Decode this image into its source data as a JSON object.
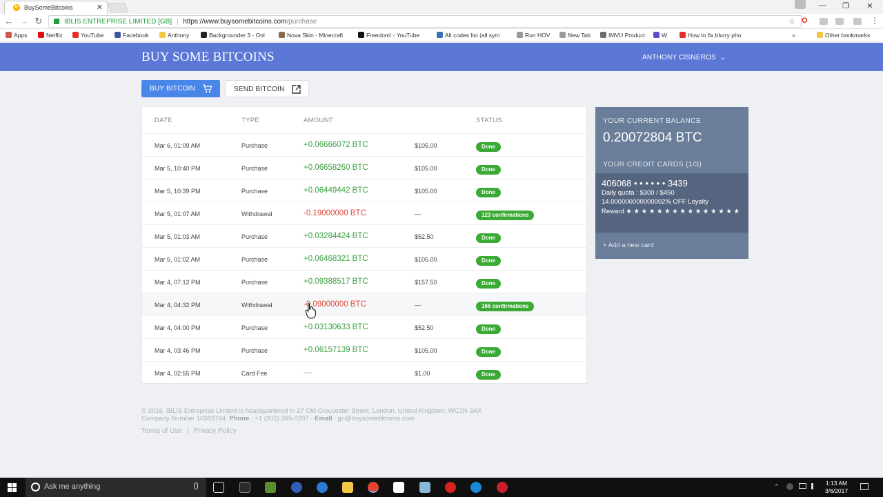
{
  "browser": {
    "tab_title": "BuySomeBitcoins",
    "tab_close": "✕",
    "win_min": "—",
    "win_restore": "❐",
    "win_close": "✕",
    "nav_back": "←",
    "nav_forward": "→",
    "nav_reload": "↻",
    "org": "IBLIS ENTREPRISE LIMITED [GB]",
    "separator": "|",
    "host": "https://www.buysomebitcoins.com",
    "path": "/purchase",
    "star": "☆",
    "bookmarks": [
      {
        "label": "Apps",
        "color": "#d05a4a"
      },
      {
        "label": "Netflix",
        "color": "#e50914"
      },
      {
        "label": "YouTube",
        "color": "#e52d27"
      },
      {
        "label": "Facebook",
        "color": "#3b5998"
      },
      {
        "label": "Anthony",
        "color": "#f2c744"
      },
      {
        "label": "Backgrounder 3 - Onl",
        "color": "#222222"
      },
      {
        "label": "Nova Skin - Minecraft",
        "color": "#8b6a4e"
      },
      {
        "label": "Freedom! - YouTube",
        "color": "#111111"
      },
      {
        "label": "Alt codes list (all sym",
        "color": "#3d6fb8"
      },
      {
        "label": "Run HOV",
        "color": "#9a9a9a"
      },
      {
        "label": "New Tab",
        "color": "#9a9a9a"
      },
      {
        "label": "IMVU Product",
        "color": "#6e6e6e"
      },
      {
        "label": "W",
        "color": "#5a4fc8"
      },
      {
        "label": "How to fix blurry pho",
        "color": "#e52d27"
      }
    ],
    "more_bookmarks": "»",
    "other_bookmarks": "Other bookmarks"
  },
  "header": {
    "logo": "BUY SOME BITCOINS",
    "user": "ANTHONY CISNEROS",
    "chevron": "⌄"
  },
  "actions": {
    "buy_label": "BUY BITCOIN",
    "buy_icon": "🛒",
    "send_label": "SEND BITCOIN",
    "send_icon": "⧉"
  },
  "table": {
    "headers": {
      "date": "DATE",
      "type": "TYPE",
      "amount": "AMOUNT",
      "status": "STATUS"
    },
    "rows": [
      {
        "date": "Mar 6, 01:09 AM",
        "type": "Purchase",
        "amount": "+0.06666072 BTC",
        "sign": "pos",
        "usd": "$105.00",
        "status": "Done"
      },
      {
        "date": "Mar 5, 10:40 PM",
        "type": "Purchase",
        "amount": "+0.06658260 BTC",
        "sign": "pos",
        "usd": "$105.00",
        "status": "Done"
      },
      {
        "date": "Mar 5, 10:39 PM",
        "type": "Purchase",
        "amount": "+0.06449442 BTC",
        "sign": "pos",
        "usd": "$105.00",
        "status": "Done"
      },
      {
        "date": "Mar 5, 01:07 AM",
        "type": "Withdrawal",
        "amount": "-0.19000000 BTC",
        "sign": "neg",
        "usd": "—",
        "status": "123 confirmations"
      },
      {
        "date": "Mar 5, 01:03 AM",
        "type": "Purchase",
        "amount": "+0.03284424 BTC",
        "sign": "pos",
        "usd": "$52.50",
        "status": "Done"
      },
      {
        "date": "Mar 5, 01:02 AM",
        "type": "Purchase",
        "amount": "+0.06468321 BTC",
        "sign": "pos",
        "usd": "$105.00",
        "status": "Done"
      },
      {
        "date": "Mar 4, 07:12 PM",
        "type": "Purchase",
        "amount": "+0.09388517 BTC",
        "sign": "pos",
        "usd": "$157.50",
        "status": "Done"
      },
      {
        "date": "Mar 4, 04:32 PM",
        "type": "Withdrawal",
        "amount": "-0.09000000 BTC",
        "sign": "neg",
        "usd": "—",
        "status": "166 confirmations"
      },
      {
        "date": "Mar 4, 04:00 PM",
        "type": "Purchase",
        "amount": "+0.03130633 BTC",
        "sign": "pos",
        "usd": "$52.50",
        "status": "Done"
      },
      {
        "date": "Mar 4, 03:46 PM",
        "type": "Purchase",
        "amount": "+0.06157139 BTC",
        "sign": "pos",
        "usd": "$105.00",
        "status": "Done"
      },
      {
        "date": "Mar 4, 02:55 PM",
        "type": "Card Fee",
        "amount": "—",
        "sign": "none",
        "usd": "$1.00",
        "status": "Done"
      }
    ]
  },
  "balance": {
    "label": "YOUR CURRENT BALANCE",
    "value": "0.20072804 BTC",
    "cards_label": "YOUR CREDIT CARDS (1/3)",
    "card_number": "406068 • • • • • • 3439",
    "daily_quota": "Daily quota : $300 / $450",
    "loyalty": "14.000000000000002% OFF Loyalty",
    "reward": "Reward ★ ★ ★ ★ ★ ★ ★ ★ ★ ★ ★ ★ ★ ★ ★",
    "add_card": "+ Add a new card"
  },
  "footer": {
    "line1": "© 2016. IBLIS Entreprise Limited is headquartered in 27 Old Gloucester Street, London, United Kingdom, WC1N 3AX",
    "company": "Company Number 10383794.",
    "phone_label": "Phone",
    "phone": ": +1 (302) 365-0207 -",
    "email_label": "Email",
    "email": ": go@buysomebitcoins.com",
    "terms": "Terms of Use",
    "sep": "|",
    "privacy": "Privacy Policy"
  },
  "taskbar": {
    "search_placeholder": "Ask me anything",
    "time": "1:13 AM",
    "date": "3/6/2017",
    "tray_up": "⌃"
  }
}
